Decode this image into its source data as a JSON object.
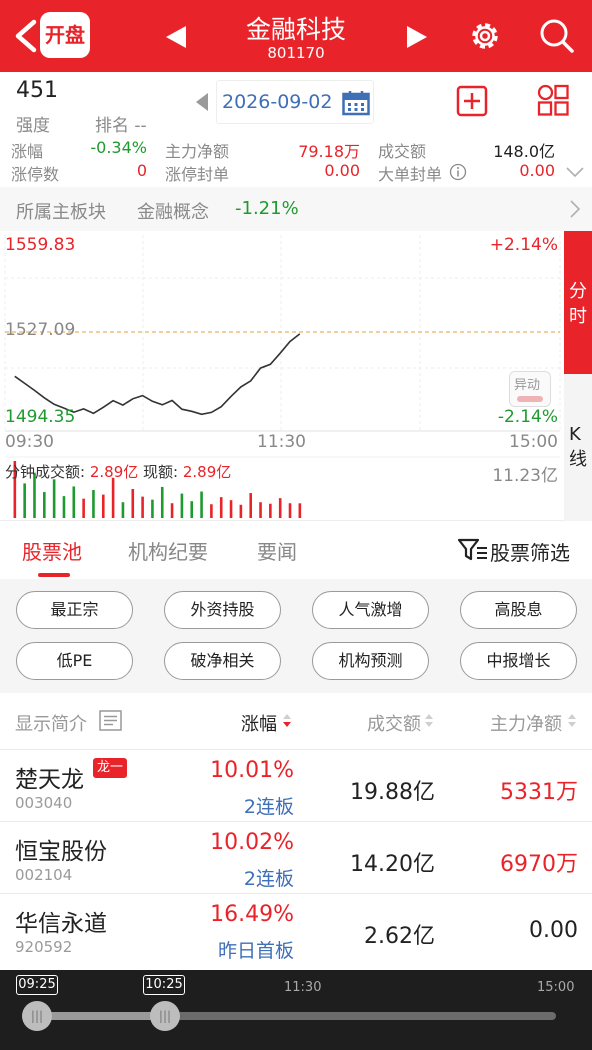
{
  "header": {
    "open_badge": "开盘",
    "title": "金融科技",
    "code": "801170"
  },
  "summary": {
    "rank_value": "451",
    "strength_label": "强度",
    "rank_label": "排名 --",
    "date": "2026-09-02"
  },
  "stats": {
    "change_label": "涨幅",
    "change_value": "-0.34%",
    "main_net_label": "主力净额",
    "main_net_value": "79.18万",
    "turnover_label": "成交额",
    "turnover_value": "148.0亿",
    "limitup_count_label": "涨停数",
    "limitup_count_value": "0",
    "limitup_order_label": "涨停封单",
    "limitup_order_value": "0.00",
    "big_order_label": "大单封单",
    "big_order_value": "0.00"
  },
  "sector": {
    "label": "所属主板块",
    "concept": "金融概念",
    "concept_change": "-1.21%"
  },
  "chart": {
    "price_high": "1559.83",
    "price_mid": "1527.09",
    "price_low": "1494.35",
    "pct_high": "+2.14%",
    "pct_low": "-2.14%",
    "time_start": "09:30",
    "time_mid": "11:30",
    "time_end": "15:00",
    "minute_turnover_label": "分钟成交额:",
    "minute_turnover_value": "2.89亿",
    "current_label": "现额:",
    "current_value": "2.89亿",
    "vol_max": "11.23亿",
    "abnormal_label": "异动",
    "tab_fenshi": "分时",
    "tab_kline": "K线",
    "colors": {
      "up": "#e8242a",
      "down": "#1f9a2f",
      "line": "#333333",
      "avg": "#e6a23c"
    }
  },
  "chart_data": {
    "type": "line",
    "title": "",
    "x_range": [
      "09:30",
      "15:00"
    ],
    "ylim": [
      1494.35,
      1559.83
    ],
    "reference": 1527.09,
    "series": [
      {
        "values": [
          1510.8,
          1508.2,
          1505.6,
          1502.9,
          1500.5,
          1499.1,
          1497.6,
          1498.8,
          1497.2,
          1499.4,
          1501.8,
          1500.2,
          1502.5,
          1503.7,
          1501.6,
          1500.3,
          1501.9,
          1498.7,
          1497.9,
          1496.8,
          1497.5,
          1499.6,
          1503.4,
          1506.9,
          1509.1,
          1513.8,
          1515.2,
          1519.3,
          1523.6,
          1526.4
        ]
      }
    ],
    "volume_max": "11.23亿",
    "volume": [
      11.2,
      6.8,
      8.9,
      5.1,
      7.6,
      4.3,
      6.2,
      3.8,
      5.5,
      4.6,
      7.9,
      3.1,
      5.7,
      4.2,
      3.6,
      6.1,
      2.9,
      4.8,
      3.3,
      5.2,
      2.7,
      4.1,
      3.5,
      2.6,
      4.9,
      3.1,
      2.8,
      3.9,
      2.9,
      2.89
    ]
  },
  "tabs": {
    "items": [
      "股票池",
      "机构纪要",
      "要闻"
    ],
    "active": 0,
    "filter_label": "股票筛选"
  },
  "chips": [
    "最正宗",
    "外资持股",
    "人气激增",
    "高股息",
    "低PE",
    "破净相关",
    "机构预测",
    "中报增长"
  ],
  "table": {
    "col_name": "显示简介",
    "col_change": "涨幅",
    "col_turnover": "成交额",
    "col_main_net": "主力净额",
    "rows": [
      {
        "name": "楚天龙",
        "badge": "龙一",
        "code": "003040",
        "change": "10.01%",
        "tag": "2连板",
        "turnover": "19.88亿",
        "main_net": "5331万",
        "net_color": "#e8242a"
      },
      {
        "name": "恒宝股份",
        "badge": "",
        "code": "002104",
        "change": "10.02%",
        "tag": "2连板",
        "turnover": "14.20亿",
        "main_net": "6970万",
        "net_color": "#e8242a"
      },
      {
        "name": "华信永道",
        "badge": "",
        "code": "920592",
        "change": "16.49%",
        "tag": "昨日首板",
        "turnover": "2.62亿",
        "main_net": "0.00",
        "net_color": "#222222"
      }
    ]
  },
  "timeline": {
    "start_label": "09:25",
    "current_label": "10:25",
    "mid_label": "11:30",
    "end_label": "15:00"
  }
}
